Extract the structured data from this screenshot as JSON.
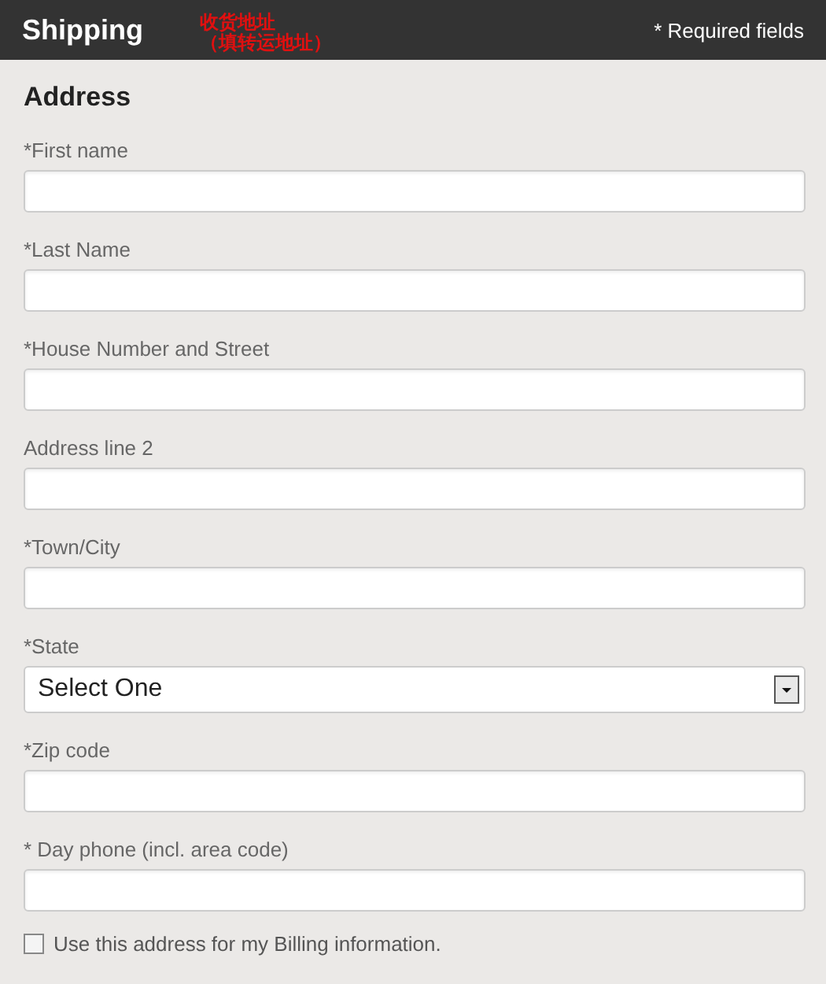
{
  "header": {
    "title": "Shipping",
    "annotation": [
      "收货地址",
      "（填转运地址）"
    ],
    "required_note": "* Required fields"
  },
  "section_title": "Address",
  "fields": [
    {
      "kind": "text",
      "label": "*First name"
    },
    {
      "kind": "text",
      "label": "*Last Name"
    },
    {
      "kind": "text",
      "label": "*House Number and Street"
    },
    {
      "kind": "text",
      "label": "Address line 2"
    },
    {
      "kind": "text",
      "label": "*Town/City"
    },
    {
      "kind": "select",
      "label": "*State",
      "value": "Select One"
    },
    {
      "kind": "text",
      "label": "*Zip code"
    },
    {
      "kind": "text",
      "label": "* Day phone (incl. area code)"
    }
  ],
  "billing_option": {
    "label": "Use this address for my Billing information.",
    "checked": false
  }
}
